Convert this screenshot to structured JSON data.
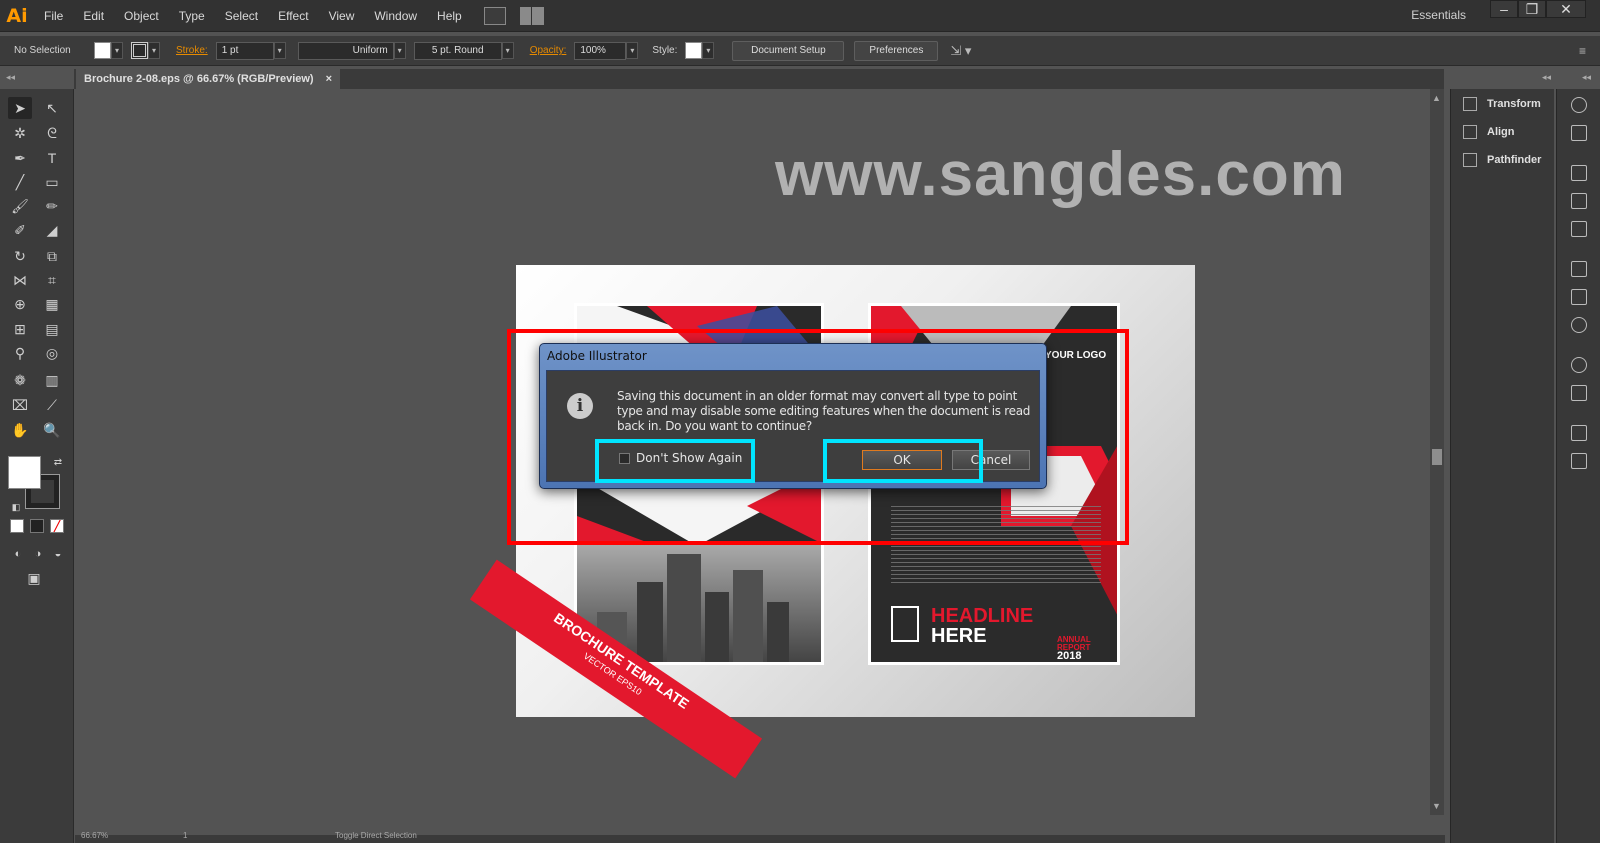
{
  "app": {
    "logo": "Ai",
    "workspace": "Essentials"
  },
  "menu": [
    "File",
    "Edit",
    "Object",
    "Type",
    "Select",
    "Effect",
    "View",
    "Window",
    "Help"
  ],
  "window_controls": {
    "minimize": "–",
    "restore": "❐",
    "close": "✕"
  },
  "control_bar": {
    "selection": "No Selection",
    "stroke_label": "Stroke:",
    "stroke_weight": "1 pt",
    "profile": "Uniform",
    "brush": "5 pt. Round",
    "opacity_label": "Opacity:",
    "opacity_value": "100%",
    "style_label": "Style:",
    "document_setup": "Document Setup",
    "preferences": "Preferences"
  },
  "document_tab": {
    "title": "Brochure 2-08.eps @ 66.67% (RGB/Preview)",
    "close": "×"
  },
  "canvas": {
    "watermark": "www.sangdes.com",
    "artwork": {
      "logo": "YOUR LOGO",
      "headline_1": "HEADLINE",
      "headline_2": "HERE",
      "annual_1": "ANNUAL",
      "annual_2": "REPORT",
      "year": "2018",
      "ribbon_main": "BROCHURE TEMPLATE",
      "ribbon_sub": "VECTOR EPS10"
    }
  },
  "dialog": {
    "title": "Adobe Illustrator",
    "icon": "info-icon",
    "message": "Saving this document in an older format may convert all type to point type and may disable some editing features when the document is read back in. Do you want to continue?",
    "checkbox_label": "Don't Show Again",
    "checkbox_checked": false,
    "ok_label": "OK",
    "cancel_label": "Cancel"
  },
  "panels": [
    {
      "name": "Transform"
    },
    {
      "name": "Align"
    },
    {
      "name": "Pathfinder"
    }
  ],
  "status": {
    "zoom": "66.67%",
    "artboard": "1",
    "tool": "Toggle Direct Selection"
  },
  "colors": {
    "accent_orange": "#e68a00",
    "annotation_red": "#ff0000",
    "annotation_cyan": "#00e5ff",
    "brochure_red": "#e3182d"
  }
}
